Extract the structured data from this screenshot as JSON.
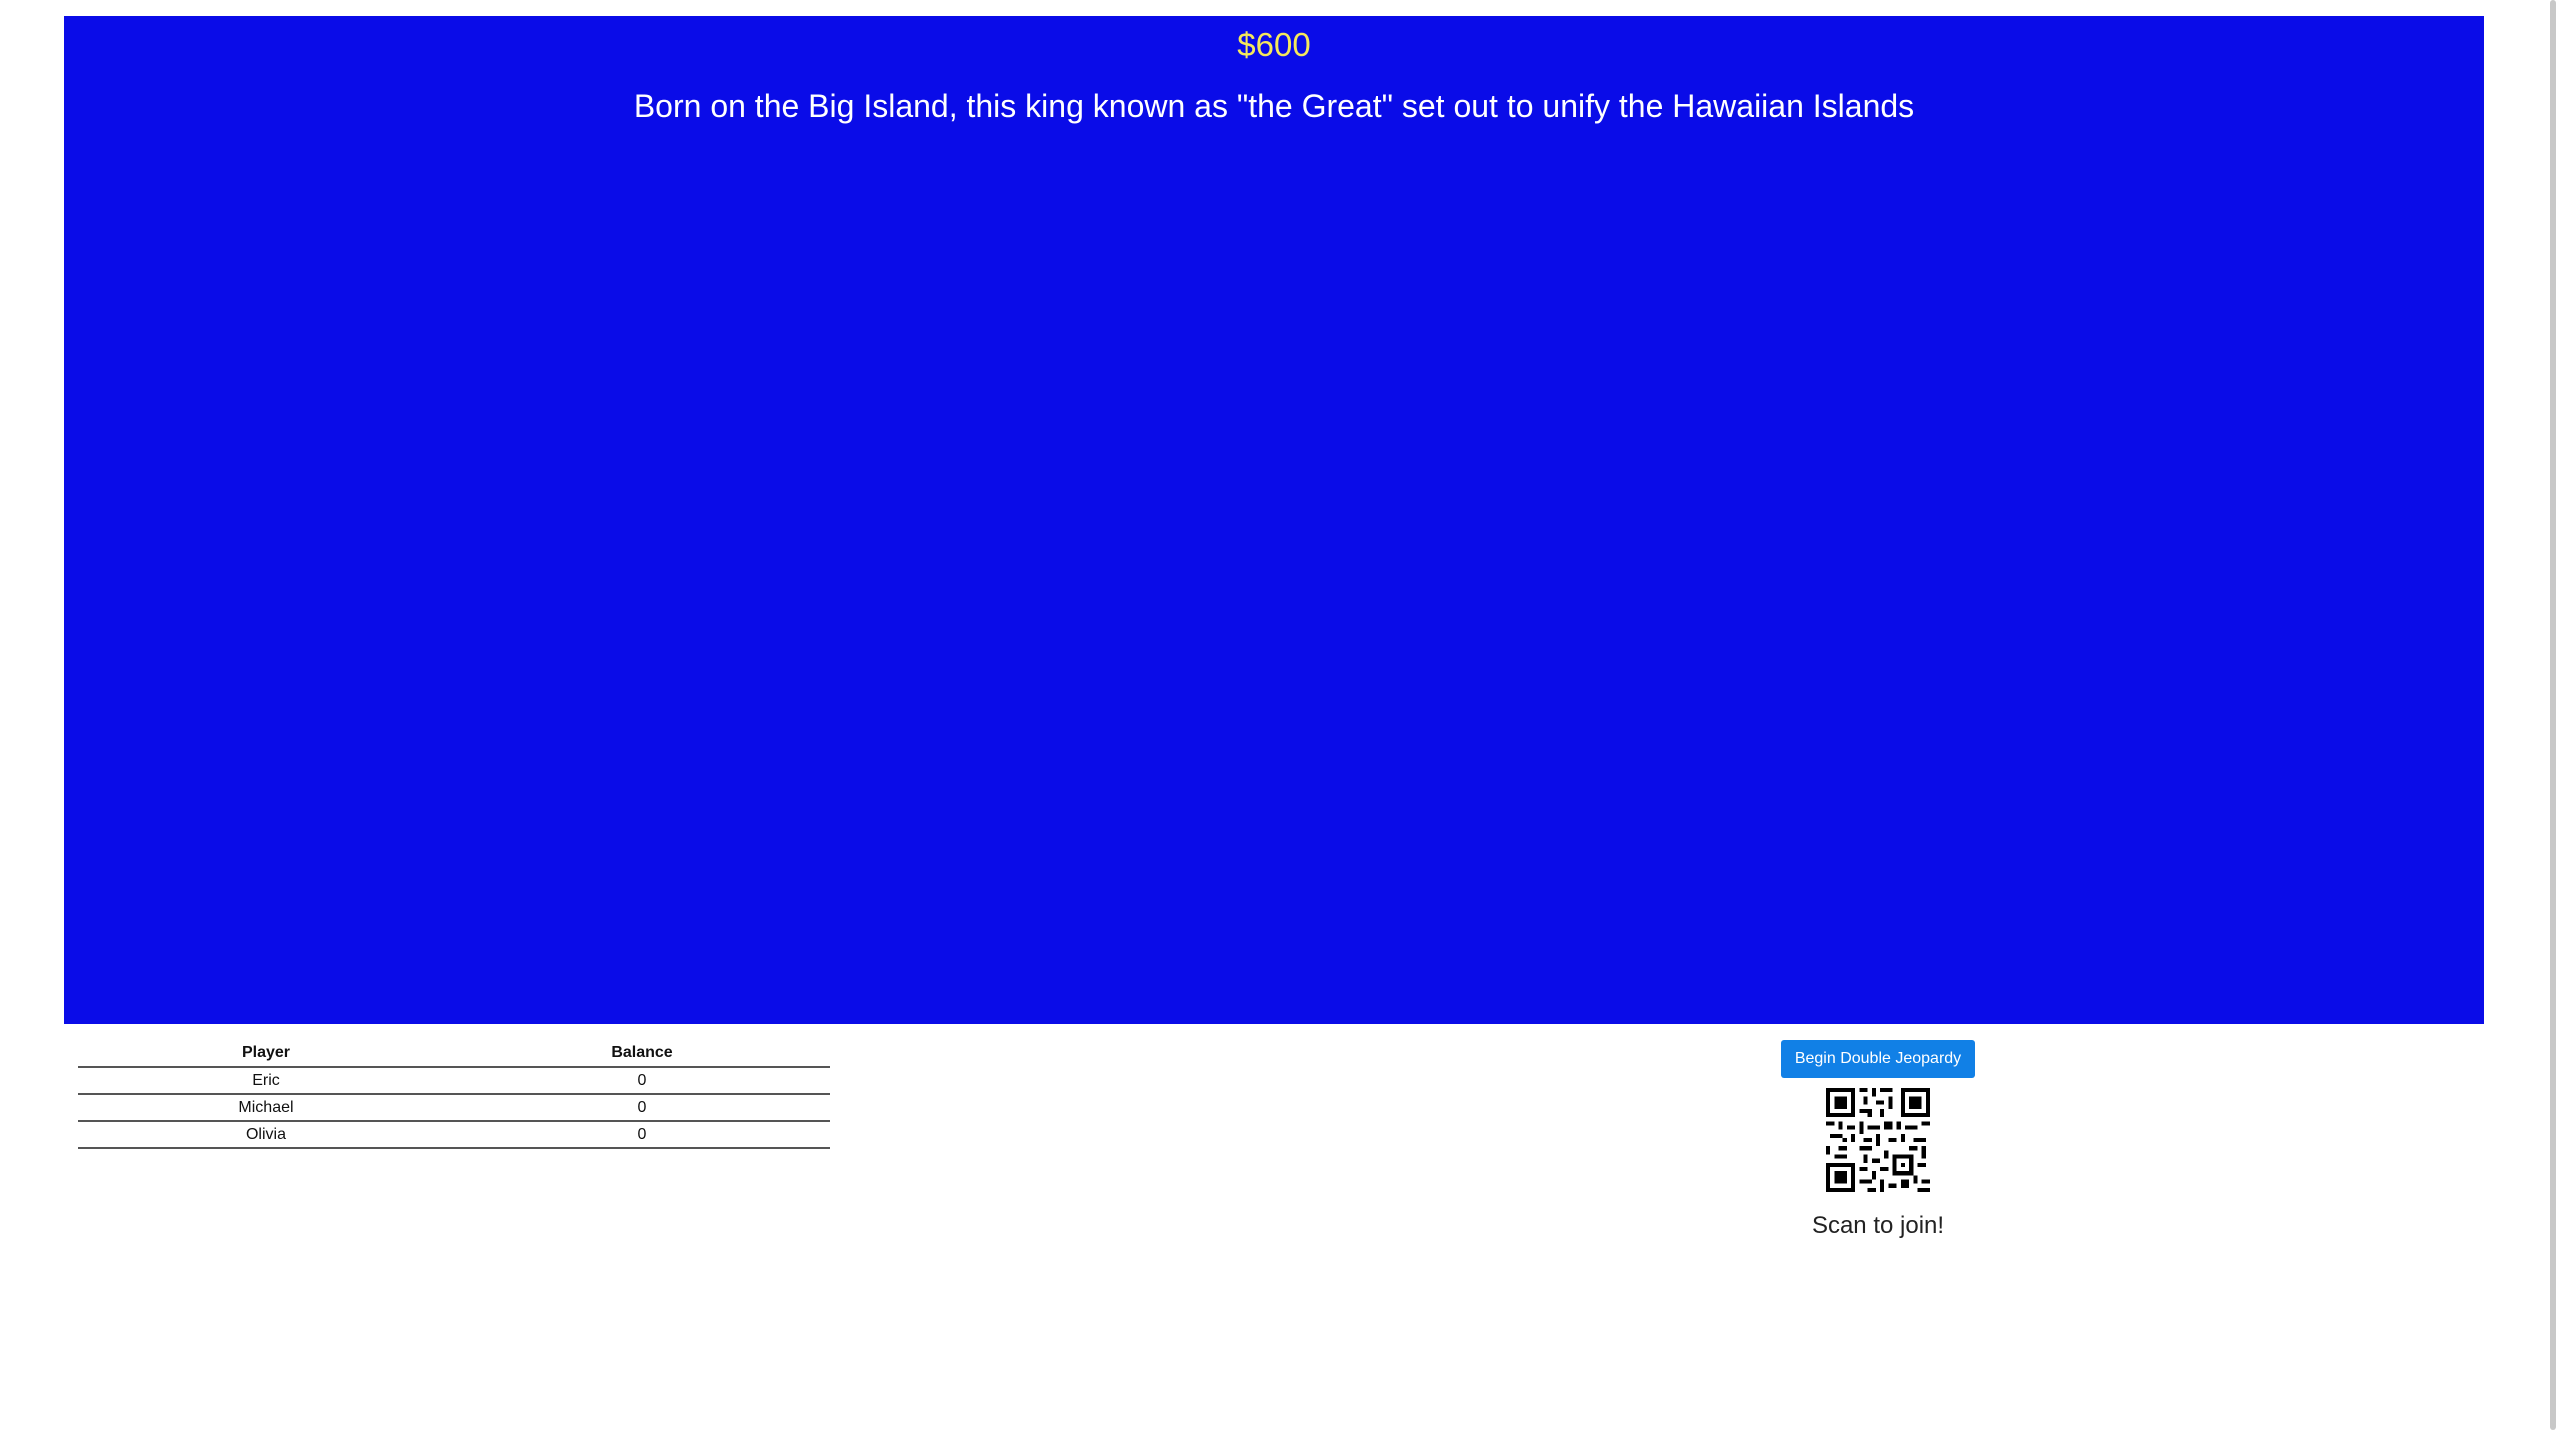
{
  "clue": {
    "value": "$600",
    "text": "Born on the Big Island, this king known as \"the Great\" set out to unify the Hawaiian Islands"
  },
  "scoreboard": {
    "headers": {
      "player": "Player",
      "balance": "Balance"
    },
    "rows": [
      {
        "player": "Eric",
        "balance": "0"
      },
      {
        "player": "Michael",
        "balance": "0"
      },
      {
        "player": "Olivia",
        "balance": "0"
      }
    ]
  },
  "actions": {
    "begin_double_label": "Begin Double Jeopardy"
  },
  "join": {
    "qr_icon": "qr-code-icon",
    "scan_text": "Scan to join!"
  },
  "colors": {
    "board": "#0a0ce8",
    "value": "#f5e85c",
    "button": "#1180e6"
  }
}
